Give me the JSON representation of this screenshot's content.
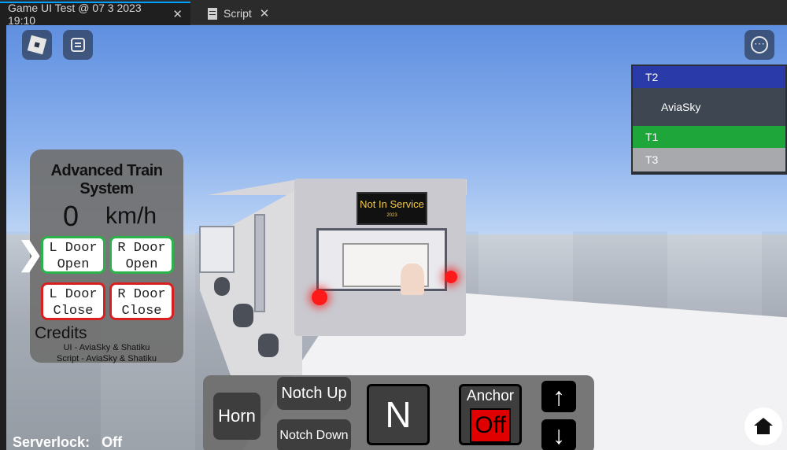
{
  "tabs": [
    {
      "label": "Game UI Test @ 07 3 2023 19:10",
      "close": "✕"
    },
    {
      "label": "Script",
      "close": "✕"
    }
  ],
  "icons": {
    "roblox": "roblox-logo-icon",
    "chat": "chat-icon",
    "menu": "more-menu-icon",
    "home": "home-icon"
  },
  "menu_glyph": "⋯",
  "teams": [
    {
      "label": "T2",
      "color": "#2a3aa8"
    },
    {
      "label": "AviaSky",
      "color": "#3e4652"
    },
    {
      "label": "T1",
      "color": "#1ea63a"
    },
    {
      "label": "T3",
      "color": "#a7a9ad"
    }
  ],
  "scene": {
    "destination": "Not In Service",
    "destination_sub": "2023"
  },
  "ats": {
    "title": "Advanced Train System",
    "speed": "0",
    "unit": "km/h",
    "l_door_open": [
      "L Door",
      "Open"
    ],
    "r_door_open": [
      "R Door",
      "Open"
    ],
    "l_door_close": [
      "L Door",
      "Close"
    ],
    "r_door_close": [
      "R Door",
      "Close"
    ],
    "credits_heading": "Credits",
    "credit_ui": "UI - AviaSky & Shatiku",
    "credit_script": "Script - AviaSky & Shatiku",
    "toggle_glyph": "❯"
  },
  "controls": {
    "horn": "Horn",
    "notch_up": "Notch Up",
    "notch_down": "Notch Down",
    "gear": "N",
    "anchor_label": "Anchor",
    "anchor_state": "Off",
    "up_arrow": "↑",
    "down_arrow": "↓"
  },
  "serverlock": {
    "label": "Serverlock:",
    "value": "Off"
  }
}
